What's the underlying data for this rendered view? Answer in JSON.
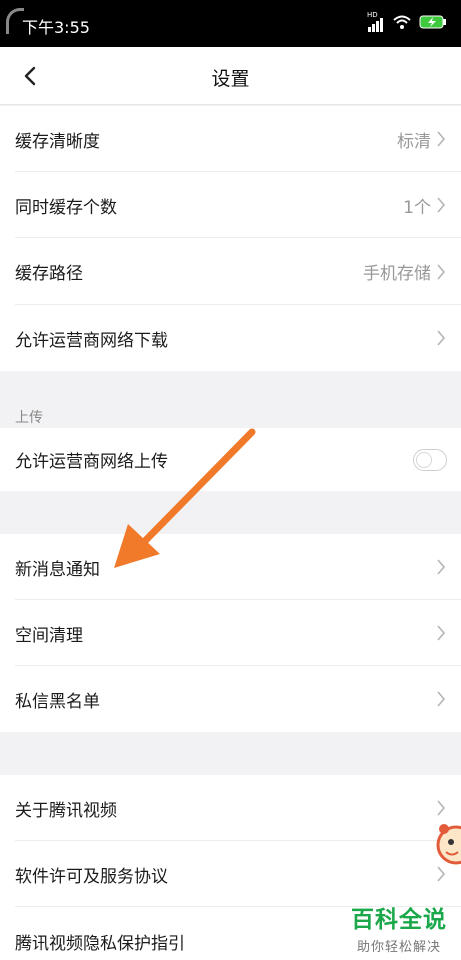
{
  "status_bar": {
    "time": "下午3:55",
    "hd": "HD"
  },
  "header": {
    "title": "设置"
  },
  "cache_section": [
    {
      "label": "缓存清晰度",
      "value": "标清"
    },
    {
      "label": "同时缓存个数",
      "value": "1个"
    },
    {
      "label": "缓存路径",
      "value": "手机存储"
    },
    {
      "label": "允许运营商网络下载",
      "value": ""
    }
  ],
  "upload_section": {
    "title": "上传",
    "item_label": "允许运营商网络上传",
    "toggle_on": false
  },
  "misc_section": [
    {
      "label": "新消息通知"
    },
    {
      "label": "空间清理"
    },
    {
      "label": "私信黑名单"
    }
  ],
  "about_section": [
    {
      "label": "关于腾讯视频"
    },
    {
      "label": "软件许可及服务协议"
    },
    {
      "label": "腾讯视频隐私保护指引"
    }
  ],
  "watermark": {
    "main": "百科全说",
    "sub": "助你轻松解决"
  },
  "colors": {
    "annotation_arrow": "#f07a2a",
    "watermark_green": "#1aa84a"
  }
}
